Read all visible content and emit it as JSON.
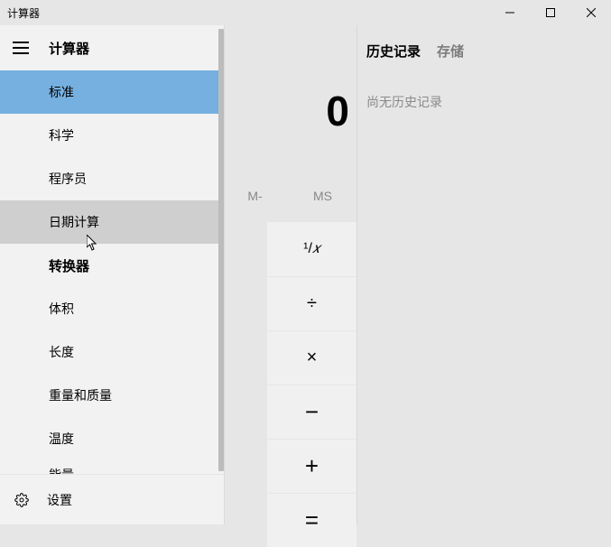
{
  "window": {
    "title": "计算器"
  },
  "nav": {
    "section_calc": "计算器",
    "standard": "标准",
    "scientific": "科学",
    "programmer": "程序员",
    "date": "日期计算",
    "section_conv": "转换器",
    "volume": "体积",
    "length": "长度",
    "weight": "重量和质量",
    "temperature": "温度",
    "energy": "能量",
    "settings": "设置"
  },
  "display": {
    "value": "0"
  },
  "memory": {
    "mminus": "M-",
    "ms": "MS"
  },
  "ops": {
    "reciprocal": "¹⁄ₓ",
    "divide": "÷",
    "multiply": "×",
    "minus": "−",
    "plus": "+",
    "equals": "="
  },
  "history": {
    "tab_history": "历史记录",
    "tab_memory": "存储",
    "empty": "尚无历史记录"
  }
}
